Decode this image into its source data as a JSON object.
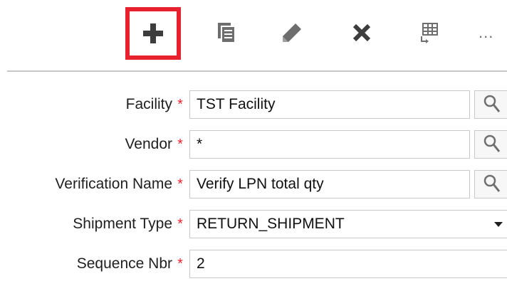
{
  "toolbar": {
    "add_icon": "plus-icon",
    "copy_icon": "copy-icon",
    "edit_icon": "pencil-icon",
    "delete_icon": "x-icon",
    "grid_icon": "grid-edit-icon",
    "more_label": "...",
    "highlight_color": "#e8212f"
  },
  "form": {
    "fields": [
      {
        "label": "Facility",
        "required_mark": "*",
        "value": "TST Facility",
        "control": "lookup"
      },
      {
        "label": "Vendor",
        "required_mark": "*",
        "value": "*",
        "control": "lookup"
      },
      {
        "label": "Verification Name",
        "required_mark": "*",
        "value": "Verify LPN total qty",
        "control": "lookup"
      },
      {
        "label": "Shipment Type",
        "required_mark": "*",
        "value": "RETURN_SHIPMENT",
        "control": "select"
      },
      {
        "label": "Sequence Nbr",
        "required_mark": "*",
        "value": "2",
        "control": "text"
      }
    ]
  },
  "colors": {
    "required": "#e8212f",
    "icon_dark": "#3d3d3d",
    "icon_gray": "#6e6e6e",
    "border": "#c9c9c9"
  }
}
